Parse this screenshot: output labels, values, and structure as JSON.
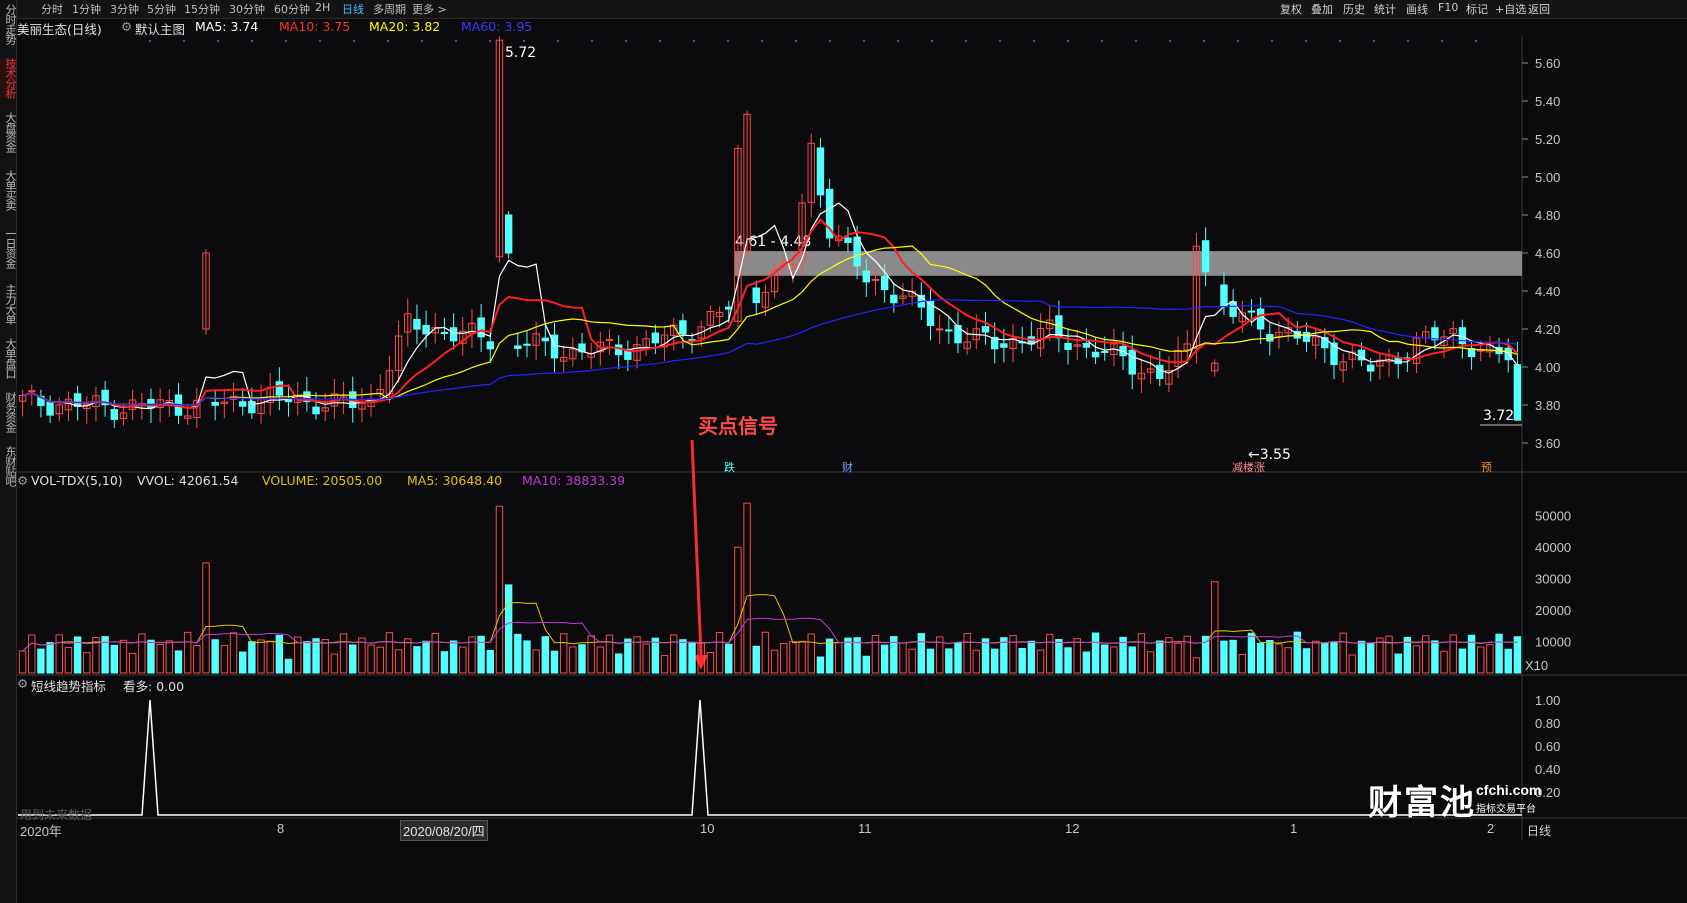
{
  "sidebar": {
    "items": [
      "分时走势",
      "技术分析",
      "大盘资金",
      "大单买卖",
      "一日资金",
      "主力大单",
      "大单盘口",
      "财务资金",
      "东财贴吧"
    ],
    "active_index": 1
  },
  "topbar": {
    "timeframes": [
      "分时",
      "1分钟",
      "3分钟",
      "5分钟",
      "15分钟",
      "30分钟",
      "60分钟",
      "2H",
      "日线",
      "多周期",
      "更多 >"
    ],
    "active": "日线",
    "right_buttons": [
      "复权",
      "叠加",
      "历史",
      "统计",
      "画线",
      "F10",
      "标记",
      "+自选",
      "返回"
    ]
  },
  "title": {
    "stock": "美丽生态(日线)",
    "template": "默认主图",
    "ma5": "MA5: 3.74",
    "ma10": "MA10: 3.75",
    "ma20": "MA20: 3.82",
    "ma60": "MA60: 3.95"
  },
  "colors": {
    "up": "#ff4a4a",
    "down": "#54ffff",
    "ma5": "#ffffff",
    "ma10": "#ff2020",
    "ma20": "#ffff00",
    "ma60": "#2222ff",
    "vol_ma5": "#e6c200",
    "vol_ma10": "#c23ad6",
    "accent": "#47b8ff"
  },
  "annotations": {
    "high": "5.72",
    "low": "←3.55",
    "zone": "4.61 - 4.48",
    "last_price": "3.72",
    "buy_signal": "买点信号",
    "events": [
      "跌",
      "财",
      "减楼涨",
      "预"
    ]
  },
  "price_axis": [
    "5.60",
    "5.40",
    "5.20",
    "5.00",
    "4.80",
    "4.60",
    "4.40",
    "4.20",
    "4.00",
    "3.80",
    "3.60"
  ],
  "volume": {
    "indicator": "VOL-TDX(5,10)",
    "vvol": "VVOL: 42061.54",
    "volume": "VOLUME: 20505.00",
    "ma5": "MA5: 30648.40",
    "ma10": "MA10: 38833.39",
    "axis": [
      "50000",
      "40000",
      "30000",
      "20000",
      "10000"
    ],
    "unit": "X10"
  },
  "indicator": {
    "name": "短线趋势指标",
    "value": "看多: 0.00",
    "axis": [
      "1.00",
      "0.80",
      "0.60",
      "0.40",
      "0.20"
    ],
    "future_note": "用到未来数据"
  },
  "x_axis": {
    "labels": [
      "2020年",
      "8",
      "10",
      "11",
      "12",
      "1",
      "2"
    ],
    "cursor_date": "2020/08/20/四"
  },
  "bottom_right": "日线",
  "watermark": {
    "logo": "财富池",
    "site": "cfchi.com",
    "tagline": "指标交易平台"
  }
}
